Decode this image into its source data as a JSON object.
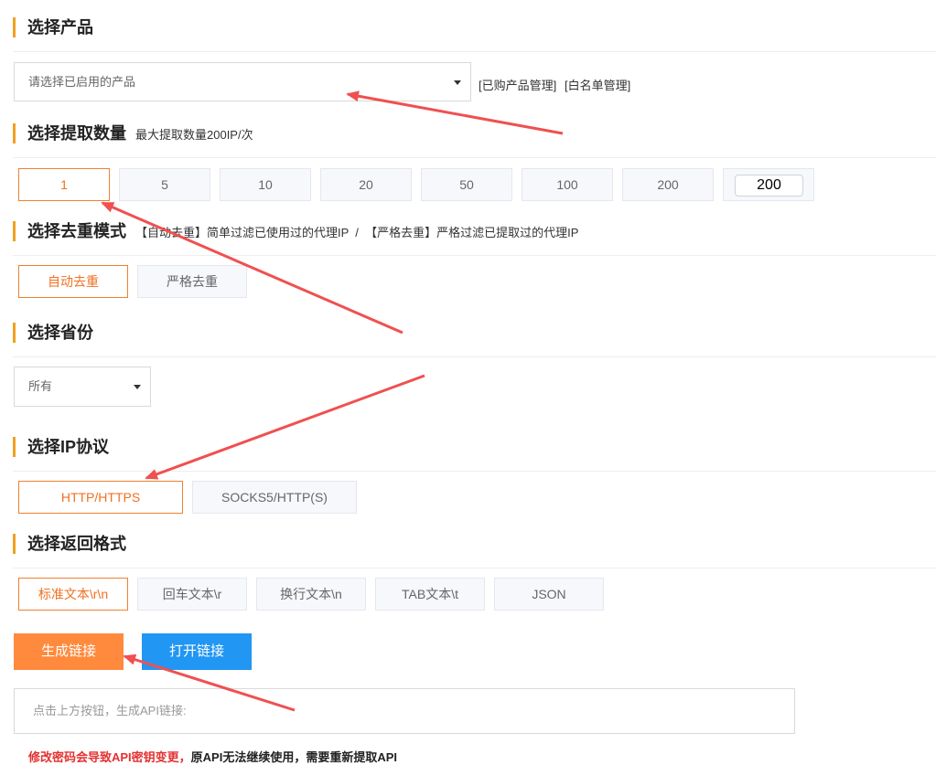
{
  "product": {
    "title": "选择产品",
    "select_placeholder": "请选择已启用的产品",
    "link_purchased": "[已购产品管理]",
    "link_whitelist": "[白名单管理]"
  },
  "quantity": {
    "title": "选择提取数量",
    "note": "最大提取数量200IP/次",
    "options": [
      "1",
      "5",
      "10",
      "20",
      "50",
      "100",
      "200"
    ],
    "selected": "1",
    "custom_value": "200"
  },
  "dedupe": {
    "title": "选择去重模式",
    "note": "【自动去重】简单过滤已使用过的代理IP  /  【严格去重】严格过滤已提取过的代理IP",
    "options": [
      "自动去重",
      "严格去重"
    ],
    "selected": "自动去重"
  },
  "province": {
    "title": "选择省份",
    "selected": "所有"
  },
  "protocol": {
    "title": "选择IP协议",
    "options": [
      "HTTP/HTTPS",
      "SOCKS5/HTTP(S)"
    ],
    "selected": "HTTP/HTTPS"
  },
  "format": {
    "title": "选择返回格式",
    "options": [
      "标准文本\\r\\n",
      "回车文本\\r",
      "换行文本\\n",
      "TAB文本\\t",
      "JSON"
    ],
    "selected": "标准文本\\r\\n"
  },
  "actions": {
    "generate_label": "生成链接",
    "open_label": "打开链接"
  },
  "result": {
    "placeholder": "点击上方按钮，生成API链接:"
  },
  "bottom_note": {
    "red": "修改密码会导致API密钥变更，",
    "dark": "原API无法继续使用，需要重新提取API"
  },
  "colors": {
    "accent_orange": "#ff8a3d",
    "accent_blue": "#2196f3",
    "annotation_arrow": "#f05050",
    "section_bar": "#f0a020"
  }
}
